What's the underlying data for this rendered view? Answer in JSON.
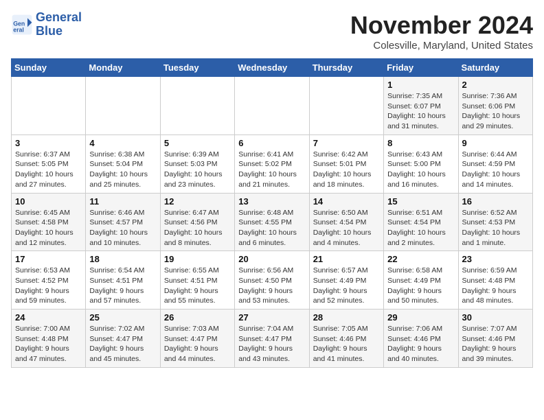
{
  "logo": {
    "line1": "General",
    "line2": "Blue"
  },
  "title": "November 2024",
  "location": "Colesville, Maryland, United States",
  "days_of_week": [
    "Sunday",
    "Monday",
    "Tuesday",
    "Wednesday",
    "Thursday",
    "Friday",
    "Saturday"
  ],
  "weeks": [
    [
      {
        "day": "",
        "info": ""
      },
      {
        "day": "",
        "info": ""
      },
      {
        "day": "",
        "info": ""
      },
      {
        "day": "",
        "info": ""
      },
      {
        "day": "",
        "info": ""
      },
      {
        "day": "1",
        "info": "Sunrise: 7:35 AM\nSunset: 6:07 PM\nDaylight: 10 hours and 31 minutes."
      },
      {
        "day": "2",
        "info": "Sunrise: 7:36 AM\nSunset: 6:06 PM\nDaylight: 10 hours and 29 minutes."
      }
    ],
    [
      {
        "day": "3",
        "info": "Sunrise: 6:37 AM\nSunset: 5:05 PM\nDaylight: 10 hours and 27 minutes."
      },
      {
        "day": "4",
        "info": "Sunrise: 6:38 AM\nSunset: 5:04 PM\nDaylight: 10 hours and 25 minutes."
      },
      {
        "day": "5",
        "info": "Sunrise: 6:39 AM\nSunset: 5:03 PM\nDaylight: 10 hours and 23 minutes."
      },
      {
        "day": "6",
        "info": "Sunrise: 6:41 AM\nSunset: 5:02 PM\nDaylight: 10 hours and 21 minutes."
      },
      {
        "day": "7",
        "info": "Sunrise: 6:42 AM\nSunset: 5:01 PM\nDaylight: 10 hours and 18 minutes."
      },
      {
        "day": "8",
        "info": "Sunrise: 6:43 AM\nSunset: 5:00 PM\nDaylight: 10 hours and 16 minutes."
      },
      {
        "day": "9",
        "info": "Sunrise: 6:44 AM\nSunset: 4:59 PM\nDaylight: 10 hours and 14 minutes."
      }
    ],
    [
      {
        "day": "10",
        "info": "Sunrise: 6:45 AM\nSunset: 4:58 PM\nDaylight: 10 hours and 12 minutes."
      },
      {
        "day": "11",
        "info": "Sunrise: 6:46 AM\nSunset: 4:57 PM\nDaylight: 10 hours and 10 minutes."
      },
      {
        "day": "12",
        "info": "Sunrise: 6:47 AM\nSunset: 4:56 PM\nDaylight: 10 hours and 8 minutes."
      },
      {
        "day": "13",
        "info": "Sunrise: 6:48 AM\nSunset: 4:55 PM\nDaylight: 10 hours and 6 minutes."
      },
      {
        "day": "14",
        "info": "Sunrise: 6:50 AM\nSunset: 4:54 PM\nDaylight: 10 hours and 4 minutes."
      },
      {
        "day": "15",
        "info": "Sunrise: 6:51 AM\nSunset: 4:54 PM\nDaylight: 10 hours and 2 minutes."
      },
      {
        "day": "16",
        "info": "Sunrise: 6:52 AM\nSunset: 4:53 PM\nDaylight: 10 hours and 1 minute."
      }
    ],
    [
      {
        "day": "17",
        "info": "Sunrise: 6:53 AM\nSunset: 4:52 PM\nDaylight: 9 hours and 59 minutes."
      },
      {
        "day": "18",
        "info": "Sunrise: 6:54 AM\nSunset: 4:51 PM\nDaylight: 9 hours and 57 minutes."
      },
      {
        "day": "19",
        "info": "Sunrise: 6:55 AM\nSunset: 4:51 PM\nDaylight: 9 hours and 55 minutes."
      },
      {
        "day": "20",
        "info": "Sunrise: 6:56 AM\nSunset: 4:50 PM\nDaylight: 9 hours and 53 minutes."
      },
      {
        "day": "21",
        "info": "Sunrise: 6:57 AM\nSunset: 4:49 PM\nDaylight: 9 hours and 52 minutes."
      },
      {
        "day": "22",
        "info": "Sunrise: 6:58 AM\nSunset: 4:49 PM\nDaylight: 9 hours and 50 minutes."
      },
      {
        "day": "23",
        "info": "Sunrise: 6:59 AM\nSunset: 4:48 PM\nDaylight: 9 hours and 48 minutes."
      }
    ],
    [
      {
        "day": "24",
        "info": "Sunrise: 7:00 AM\nSunset: 4:48 PM\nDaylight: 9 hours and 47 minutes."
      },
      {
        "day": "25",
        "info": "Sunrise: 7:02 AM\nSunset: 4:47 PM\nDaylight: 9 hours and 45 minutes."
      },
      {
        "day": "26",
        "info": "Sunrise: 7:03 AM\nSunset: 4:47 PM\nDaylight: 9 hours and 44 minutes."
      },
      {
        "day": "27",
        "info": "Sunrise: 7:04 AM\nSunset: 4:47 PM\nDaylight: 9 hours and 43 minutes."
      },
      {
        "day": "28",
        "info": "Sunrise: 7:05 AM\nSunset: 4:46 PM\nDaylight: 9 hours and 41 minutes."
      },
      {
        "day": "29",
        "info": "Sunrise: 7:06 AM\nSunset: 4:46 PM\nDaylight: 9 hours and 40 minutes."
      },
      {
        "day": "30",
        "info": "Sunrise: 7:07 AM\nSunset: 4:46 PM\nDaylight: 9 hours and 39 minutes."
      }
    ]
  ]
}
